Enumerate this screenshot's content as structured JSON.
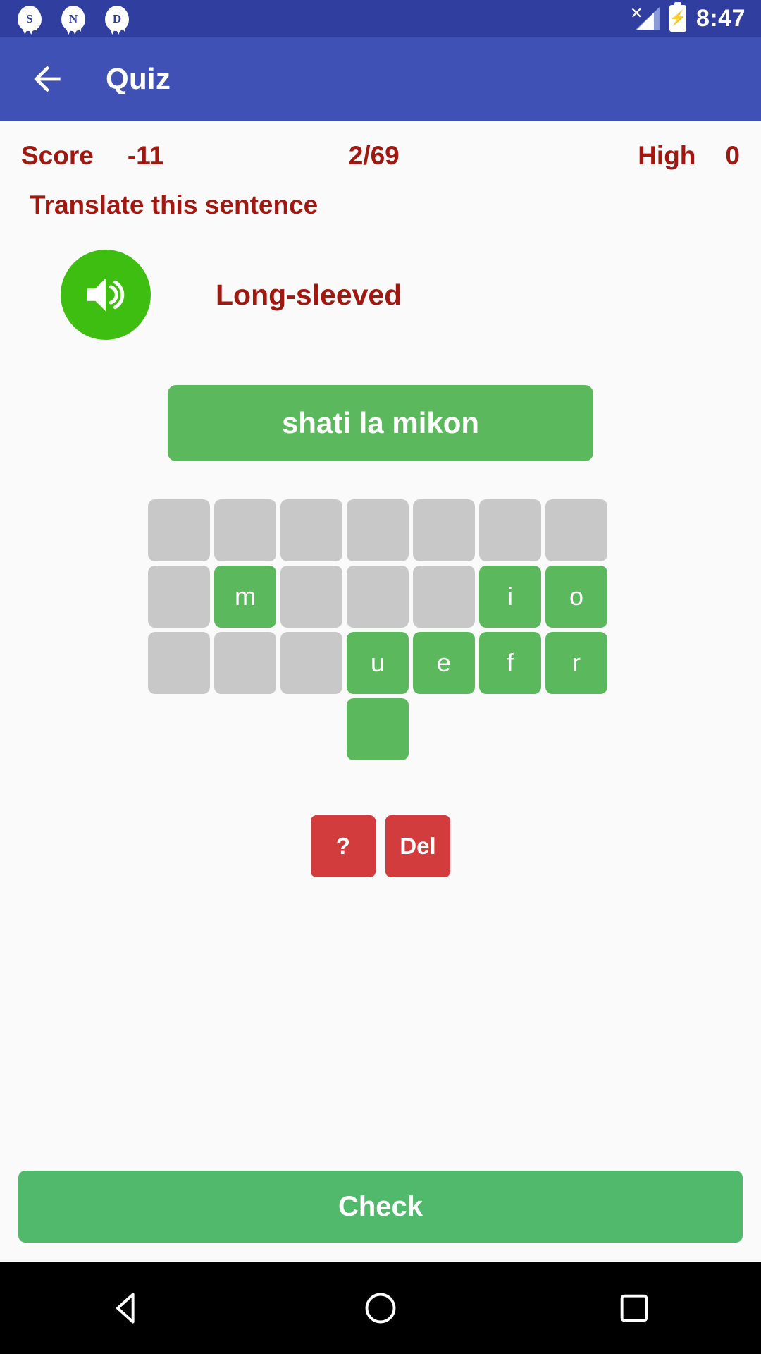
{
  "status_bar": {
    "notifications": [
      {
        "icon": "notification-bubble-icon",
        "letter": "S"
      },
      {
        "icon": "notification-bubble-icon",
        "letter": "N"
      },
      {
        "icon": "notification-bubble-icon",
        "letter": "D"
      }
    ],
    "signal_icon": "signal-no-service-icon",
    "battery_icon": "battery-charging-icon",
    "time": "8:47",
    "background_color": "#303F9F"
  },
  "app_bar": {
    "back_icon": "back-arrow-icon",
    "title": "Quiz",
    "background_color": "#3F51B5"
  },
  "quiz": {
    "score_label": "Score",
    "score_value": "-11",
    "progress": "2/69",
    "high_label": "High",
    "high_value": "0",
    "accent_color": "#A0180F",
    "instruction": "Translate this sentence",
    "audio_icon": "speaker-volume-icon",
    "audio_button_color": "#3FBE12",
    "word": "Long-sleeved",
    "answer_text": "shati la mikon",
    "answer_box_color": "#5CB85C",
    "tile_empty_color": "#C8C8C8",
    "tile_filled_color": "#5CB85C",
    "tiles": [
      [
        {
          "letter": "",
          "state": "empty"
        },
        {
          "letter": "",
          "state": "empty"
        },
        {
          "letter": "",
          "state": "empty"
        },
        {
          "letter": "",
          "state": "empty"
        },
        {
          "letter": "",
          "state": "empty"
        },
        {
          "letter": "",
          "state": "empty"
        },
        {
          "letter": "",
          "state": "empty"
        }
      ],
      [
        {
          "letter": "",
          "state": "empty"
        },
        {
          "letter": "m",
          "state": "filled"
        },
        {
          "letter": "",
          "state": "empty"
        },
        {
          "letter": "",
          "state": "empty"
        },
        {
          "letter": "",
          "state": "empty"
        },
        {
          "letter": "i",
          "state": "filled"
        },
        {
          "letter": "o",
          "state": "filled"
        }
      ],
      [
        {
          "letter": "",
          "state": "empty"
        },
        {
          "letter": "",
          "state": "empty"
        },
        {
          "letter": "",
          "state": "empty"
        },
        {
          "letter": "u",
          "state": "filled"
        },
        {
          "letter": "e",
          "state": "filled"
        },
        {
          "letter": "f",
          "state": "filled"
        },
        {
          "letter": "r",
          "state": "filled"
        }
      ],
      [
        {
          "letter": "",
          "state": "spacer"
        },
        {
          "letter": "",
          "state": "spacer"
        },
        {
          "letter": "",
          "state": "spacer"
        },
        {
          "letter": "",
          "state": "filled"
        },
        {
          "letter": "",
          "state": "spacer"
        },
        {
          "letter": "",
          "state": "spacer"
        },
        {
          "letter": "",
          "state": "spacer"
        }
      ]
    ],
    "hint_button": "?",
    "delete_button": "Del",
    "action_button_color": "#D33C3C",
    "check_button": "Check",
    "check_button_color": "#51B96B"
  },
  "nav_bar": {
    "back_icon": "nav-back-triangle-icon",
    "home_icon": "nav-home-circle-icon",
    "recents_icon": "nav-recents-square-icon",
    "background_color": "#000000"
  }
}
